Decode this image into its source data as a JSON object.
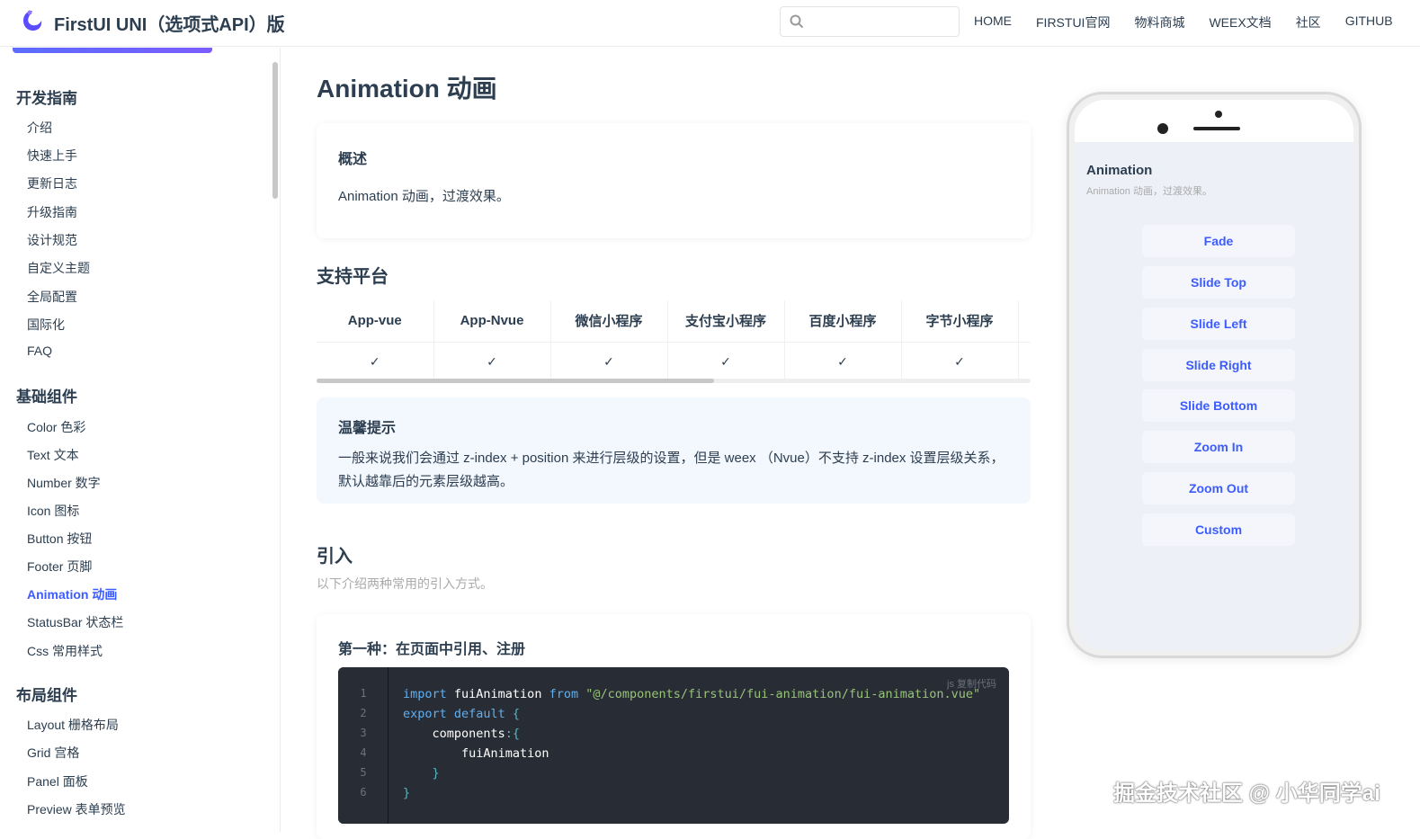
{
  "header": {
    "site_title": "FirstUI UNI（选项式API）版",
    "search_placeholder": "",
    "nav": [
      "HOME",
      "FIRSTUI官网",
      "物料商城",
      "WEEX文档",
      "社区",
      "GITHUB"
    ]
  },
  "sidebar": {
    "groups": [
      {
        "title": "开发指南",
        "items": [
          "介绍",
          "快速上手",
          "更新日志",
          "升级指南",
          "设计规范",
          "自定义主题",
          "全局配置",
          "国际化",
          "FAQ"
        ]
      },
      {
        "title": "基础组件",
        "items": [
          "Color 色彩",
          "Text 文本",
          "Number 数字",
          "Icon 图标",
          "Button 按钮",
          "Footer 页脚",
          "Animation 动画",
          "StatusBar 状态栏",
          "Css 常用样式"
        ]
      },
      {
        "title": "布局组件",
        "items": [
          "Layout 栅格布局",
          "Grid 宫格",
          "Panel 面板",
          "Preview 表单预览"
        ]
      }
    ],
    "active_item": "Animation 动画"
  },
  "main": {
    "page_title": "Animation 动画",
    "overview": {
      "title": "概述",
      "text": "Animation 动画，过渡效果。"
    },
    "platforms_title": "支持平台",
    "platforms": {
      "headers": [
        "App-vue",
        "App-Nvue",
        "微信小程序",
        "支付宝小程序",
        "百度小程序",
        "字节小程序"
      ],
      "values": [
        "✓",
        "✓",
        "✓",
        "✓",
        "✓",
        "✓"
      ]
    },
    "tip": {
      "title": "温馨提示",
      "text": "一般来说我们会通过 z-index + position 来进行层级的设置，但是 weex （Nvue）不支持 z-index 设置层级关系，默认越靠后的元素层级越高。"
    },
    "import_title": "引入",
    "import_desc": "以下介绍两种常用的引入方式。",
    "method1": {
      "title": "第一种：在页面中引用、注册",
      "lang_label": "js  复制代码",
      "line_numbers": [
        "1",
        "2",
        "3",
        "4",
        "5",
        "6"
      ],
      "code": {
        "l1_kw": "import",
        "l1_name": " fuiAnimation ",
        "l1_from": "from",
        "l1_str": " \"@/components/firstui/fui-animation/fui-animation.vue\"",
        "l2_kw": "export default",
        "l2_rest": " {",
        "l3": "    components",
        "l3_p": ":{",
        "l4": "        fuiAnimation",
        "l5": "    }",
        "l6": "}"
      }
    }
  },
  "preview": {
    "app_title": "Animation",
    "app_desc": "Animation 动画，过渡效果。",
    "buttons": [
      "Fade",
      "Slide Top",
      "Slide Left",
      "Slide Right",
      "Slide Bottom",
      "Zoom In",
      "Zoom Out",
      "Custom"
    ]
  },
  "watermark": "掘金技术社区 @ 小华同学ai",
  "colors": {
    "accent": "#3c5cff",
    "text": "#2c3e50",
    "code_bg": "#282c34"
  }
}
